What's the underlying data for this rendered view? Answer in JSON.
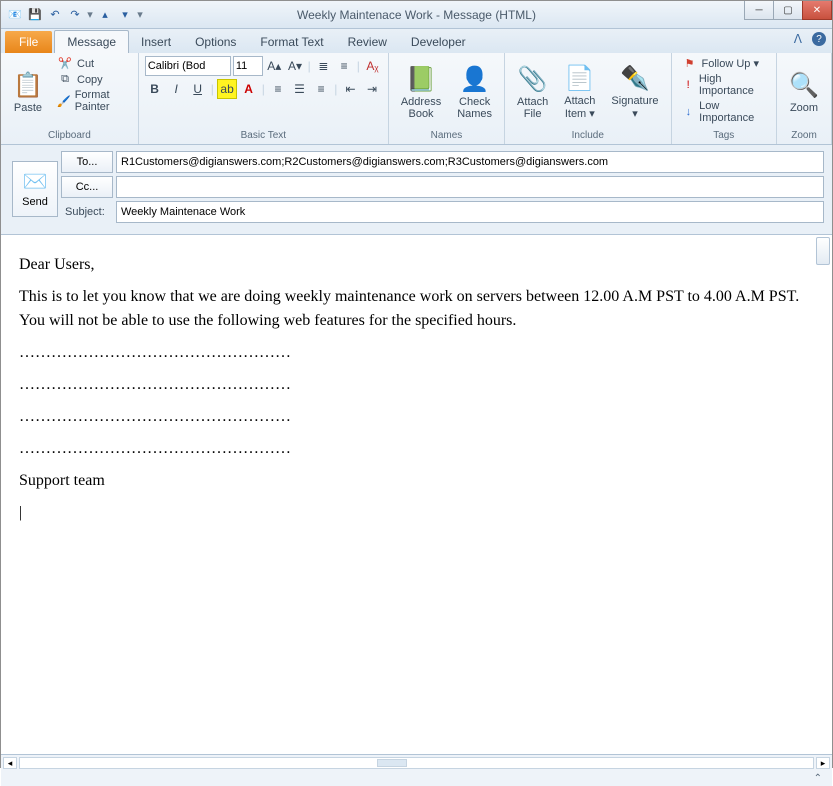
{
  "window": {
    "title": "Weekly Maintenace Work - Message (HTML)"
  },
  "tabs": {
    "file": "File",
    "items": [
      {
        "label": "Message"
      },
      {
        "label": "Insert"
      },
      {
        "label": "Options"
      },
      {
        "label": "Format Text"
      },
      {
        "label": "Review"
      },
      {
        "label": "Developer"
      }
    ]
  },
  "ribbon": {
    "clipboard": {
      "paste": "Paste",
      "cut": "Cut",
      "copy": "Copy",
      "format_painter": "Format Painter",
      "group": "Clipboard"
    },
    "basic_text": {
      "font_name": "Calibri (Bod",
      "font_size": "11",
      "group": "Basic Text"
    },
    "names": {
      "address_book": "Address\nBook",
      "check_names": "Check\nNames",
      "group": "Names"
    },
    "include": {
      "attach_file": "Attach\nFile",
      "attach_item": "Attach\nItem ▾",
      "signature": "Signature\n▾",
      "group": "Include"
    },
    "tags": {
      "follow_up": "Follow Up ▾",
      "high_importance": "High Importance",
      "low_importance": "Low Importance",
      "group": "Tags"
    },
    "zoom": {
      "zoom": "Zoom",
      "group": "Zoom"
    }
  },
  "compose": {
    "send": "Send",
    "to_label": "To...",
    "cc_label": "Cc...",
    "subject_label": "Subject:",
    "to_value": "R1Customers@digianswers.com;R2Customers@digianswers.com;R3Customers@digianswers.com",
    "cc_value": "",
    "subject_value": "Weekly Maintenace Work"
  },
  "body": {
    "greeting": "Dear Users,",
    "para1": "This is to let you know that we are doing weekly maintenance work on servers between 12.00 A.M PST to 4.00 A.M PST. You will not be able to use the following web features for the specified hours.",
    "dots": "……………………………………………",
    "signoff": "Support team",
    "cursor": "|"
  }
}
